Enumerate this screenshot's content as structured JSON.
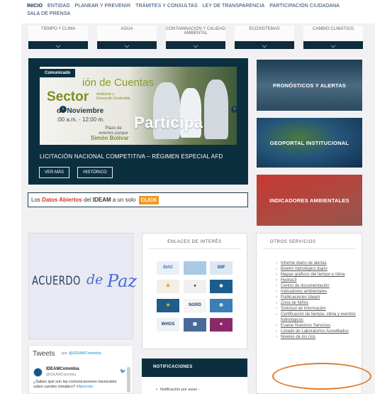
{
  "nav": {
    "items": [
      "INICIO",
      "ENTIDAD",
      "PLANEAR Y PREVENIR",
      "TRÁMITES Y CONSULTAS",
      "LEY DE TRANSPARENCIA",
      "PARTICIPACIÓN CIUDADANA",
      "SALA DE PRENSA"
    ],
    "active": "INICIO"
  },
  "tabs": [
    "TIEMPO Y CLIMA",
    "AGUA",
    "CONTAMINACIÓN Y CALIDAD AMBIENTAL",
    "ECOSISTEMAS",
    "CAMBIO CLIMÁTICO"
  ],
  "hero": {
    "badge": "Comunicado",
    "image_title": "ión de Cuentas",
    "image_sector": "Sector",
    "image_sector_sub": "Ambiente y Desarrollo Sostenible",
    "image_date": "de Noviembre",
    "image_time": ":00 a.m. - 12:00 m.",
    "image_participa": "Participa",
    "image_plazo": "Plazo de eventos parque",
    "image_bolivar": "Simón Bolívar",
    "caption": "LICITACIÓN NACIONAL COMPETITIVA – RÉGIMEN ESPECIAL AFD",
    "btn_ver_mas": "VER MÁS",
    "btn_historico": "HISTÓRICO"
  },
  "thumbs": {
    "pronosticos": "PRONÓSTICOS Y ALERTAS",
    "geoportal": "GEOPORTAL INSTITUCIONAL",
    "indicadores": "INDICADORES AMBIENTALES"
  },
  "datos": {
    "pre": "Los ",
    "highlight": "Datos Abiertos",
    "mid": " del ",
    "org": "IDEAM",
    "post": " a un solo ",
    "click": "CLICK"
  },
  "acuerdo": {
    "word1": "ACUERDO",
    "word2": "de",
    "word3": "Paz"
  },
  "tweets": {
    "title": "Tweets",
    "by_label": "por",
    "by_handle": "@IDEAMColombia",
    "name": "IDEAMColombia",
    "handle": "@IDEAMColombia",
    "text": "¿Sabes qué son las comunicaciones nacionales sobre cambio climático?",
    "hashtag": "#Aprende"
  },
  "enlaces": {
    "title": "ENLACES DE INTERÉS",
    "logos": [
      {
        "label": "SIAC",
        "color": "#3a6fb0",
        "bg": "#e8f0f8"
      },
      {
        "label": "",
        "color": "#5b8fc0",
        "bg": "#a9c9e4"
      },
      {
        "label": "SIIF",
        "color": "#1d4f8a",
        "bg": "#dde7f2"
      },
      {
        "label": "✿",
        "color": "#c89a3a",
        "bg": "#f4efe4"
      },
      {
        "label": "●",
        "color": "#222222",
        "bg": "#f0f0f0"
      },
      {
        "label": "◉",
        "color": "#ffffff",
        "bg": "#1b5d8e"
      },
      {
        "label": "◈",
        "color": "#f2c230",
        "bg": "#1f5d8a"
      },
      {
        "label": "NGRD",
        "color": "#1d3f6a",
        "bg": "#f5f5f5"
      },
      {
        "label": "◍",
        "color": "#ffffff",
        "bg": "#3b7fb8"
      },
      {
        "label": "WHOS",
        "color": "#1d3f6a",
        "bg": "#eef2f6"
      },
      {
        "label": "▦",
        "color": "#ffffff",
        "bg": "#4a6a9a"
      },
      {
        "label": "♣",
        "color": "#ffffff",
        "bg": "#8a2a6a"
      }
    ]
  },
  "notificaciones": {
    "title": "NOTIFICACIONES",
    "item": "Notificación por aviso -"
  },
  "otros": {
    "title": "OTROS SERVICIOS",
    "items": [
      "Informe diario de alertas",
      "Boletín hidrológico diario",
      "Mapas gráficos del tiempo y clima",
      "Hydras3",
      "Centro de documentación",
      "Indicadores ambientales",
      "Publicaciones Ideam",
      "Zona de Niños",
      "Solicitud de información",
      "Certificación de tiempo, clima y eventos hidrológicos",
      "Evalúe Nuestros Servicios",
      "Listado de Laboratorios Acreditados",
      "Niveles de los ríos"
    ]
  },
  "colors": {
    "dark_navy": "#0b2f3f",
    "accent_orange": "#f39a1e",
    "annotation": "#e07b2b",
    "link_red": "#d0342c"
  }
}
